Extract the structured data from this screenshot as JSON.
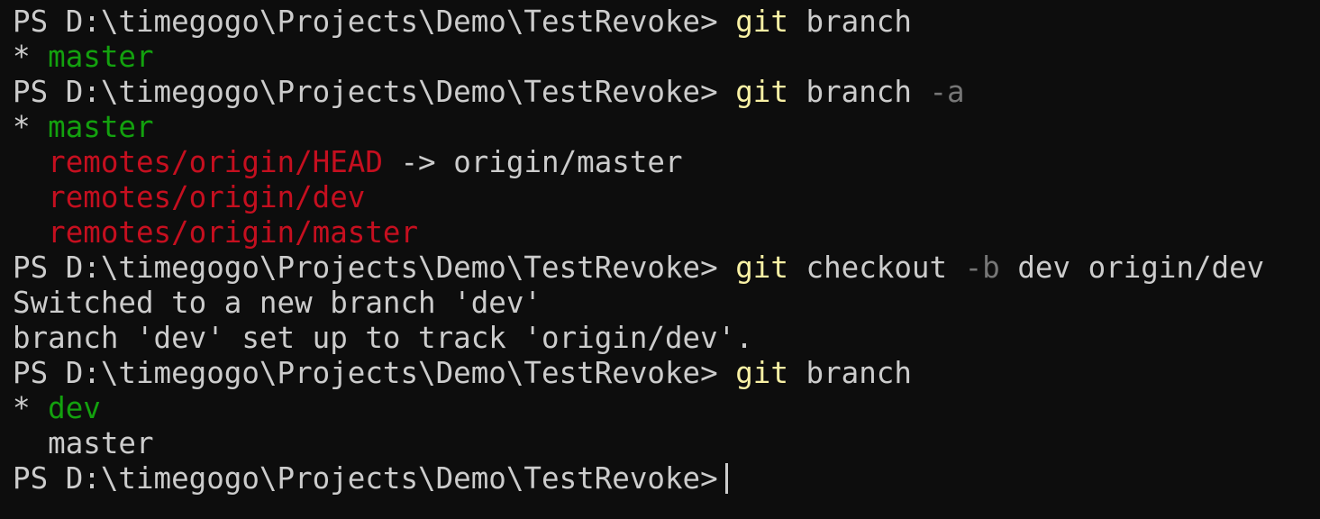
{
  "terminal": {
    "shell": "PowerShell",
    "background_color": "#0d0d0d",
    "colors": {
      "default_text": "#cccccc",
      "command_highlight": "#f9f1a5",
      "parameter_dim": "#767676",
      "local_branch_green": "#13a10e",
      "remote_branch_red": "#c50f1f",
      "cursor": "#cccccc"
    },
    "prompt": "PS D:\\timegogo\\Projects\\Demo\\TestRevoke>",
    "working_directory": "D:\\timegogo\\Projects\\Demo\\TestRevoke",
    "cursor_visible": true,
    "lines": [
      {
        "id": "line-1",
        "kind": "prompt-command",
        "segments": [
          {
            "text": "PS D:\\timegogo\\Projects\\Demo\\TestRevoke> ",
            "color": "default"
          },
          {
            "text": "git",
            "color": "yellow"
          },
          {
            "text": " branch",
            "color": "white"
          }
        ]
      },
      {
        "id": "line-2",
        "kind": "output",
        "segments": [
          {
            "text": "* ",
            "color": "white"
          },
          {
            "text": "master",
            "color": "green"
          }
        ]
      },
      {
        "id": "line-3",
        "kind": "prompt-command",
        "segments": [
          {
            "text": "PS D:\\timegogo\\Projects\\Demo\\TestRevoke> ",
            "color": "default"
          },
          {
            "text": "git",
            "color": "yellow"
          },
          {
            "text": " branch ",
            "color": "white"
          },
          {
            "text": "-a",
            "color": "dim"
          }
        ]
      },
      {
        "id": "line-4",
        "kind": "output",
        "segments": [
          {
            "text": "* ",
            "color": "white"
          },
          {
            "text": "master",
            "color": "green"
          }
        ]
      },
      {
        "id": "line-5",
        "kind": "output",
        "segments": [
          {
            "text": "  ",
            "color": "white"
          },
          {
            "text": "remotes/origin/HEAD",
            "color": "red"
          },
          {
            "text": " -> origin/master",
            "color": "white"
          }
        ]
      },
      {
        "id": "line-6",
        "kind": "output",
        "segments": [
          {
            "text": "  ",
            "color": "white"
          },
          {
            "text": "remotes/origin/dev",
            "color": "red"
          }
        ]
      },
      {
        "id": "line-7",
        "kind": "output",
        "segments": [
          {
            "text": "  ",
            "color": "white"
          },
          {
            "text": "remotes/origin/master",
            "color": "red"
          }
        ]
      },
      {
        "id": "line-8",
        "kind": "prompt-command",
        "segments": [
          {
            "text": "PS D:\\timegogo\\Projects\\Demo\\TestRevoke> ",
            "color": "default"
          },
          {
            "text": "git",
            "color": "yellow"
          },
          {
            "text": " checkout ",
            "color": "white"
          },
          {
            "text": "-b",
            "color": "dim"
          },
          {
            "text": " dev origin/dev",
            "color": "white"
          }
        ]
      },
      {
        "id": "line-9",
        "kind": "output",
        "segments": [
          {
            "text": "Switched to a new branch 'dev'",
            "color": "white"
          }
        ]
      },
      {
        "id": "line-10",
        "kind": "output",
        "segments": [
          {
            "text": "branch 'dev' set up to track 'origin/dev'.",
            "color": "white"
          }
        ]
      },
      {
        "id": "line-11",
        "kind": "prompt-command",
        "segments": [
          {
            "text": "PS D:\\timegogo\\Projects\\Demo\\TestRevoke> ",
            "color": "default"
          },
          {
            "text": "git",
            "color": "yellow"
          },
          {
            "text": " branch",
            "color": "white"
          }
        ]
      },
      {
        "id": "line-12",
        "kind": "output",
        "segments": [
          {
            "text": "* ",
            "color": "white"
          },
          {
            "text": "dev",
            "color": "green"
          }
        ]
      },
      {
        "id": "line-13",
        "kind": "output",
        "segments": [
          {
            "text": "  master",
            "color": "white"
          }
        ]
      },
      {
        "id": "line-14",
        "kind": "prompt-active",
        "segments": [
          {
            "text": "PS D:\\timegogo\\Projects\\Demo\\TestRevoke>",
            "color": "default"
          }
        ],
        "cursor": true
      }
    ]
  }
}
